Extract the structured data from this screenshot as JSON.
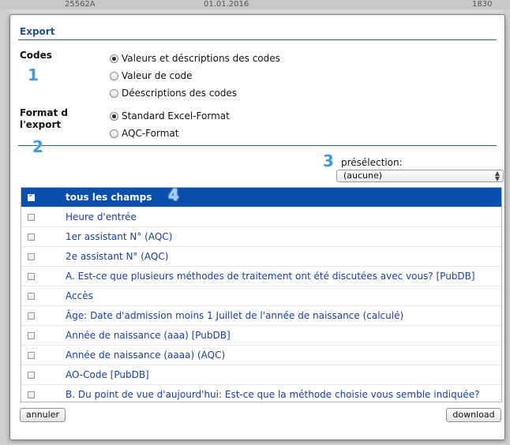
{
  "background": {
    "top_texts": [
      "25562A",
      "01.01.2016",
      "1830"
    ]
  },
  "dialog": {
    "title": "Export",
    "codes": {
      "label": "Codes",
      "badge": "1",
      "options": [
        {
          "label": "Valeurs et déscriptions des codes",
          "checked": true
        },
        {
          "label": "Valeur de code",
          "checked": false
        },
        {
          "label": "Déescriptions des codes",
          "checked": false
        }
      ]
    },
    "format": {
      "label_line1": "Format d",
      "label_line2": "l'export",
      "options": [
        {
          "label": "Standard Excel-Format",
          "checked": true
        },
        {
          "label": "AQC-Format",
          "checked": false
        }
      ]
    },
    "badge2": "2",
    "preselection": {
      "badge": "3",
      "label": "présélection:",
      "value": "(aucune)"
    },
    "list": {
      "badge": "4",
      "items": [
        {
          "label": "tous les champs",
          "checked": true
        },
        {
          "label": "Heure d'entrée",
          "checked": false
        },
        {
          "label": "1er assistant N° (AQC)",
          "checked": false
        },
        {
          "label": "2e assistant N° (AQC)",
          "checked": false
        },
        {
          "label": "A. Est-ce que plusieurs méthodes de traitement ont été discutées avec vous? [PubDB]",
          "checked": false
        },
        {
          "label": "Accès",
          "checked": false
        },
        {
          "label": "Âge: Date d'admission moins 1 Juillet de l'année de naissance (calculé)",
          "checked": false
        },
        {
          "label": "Année de naissance (aaa) [PubDB]",
          "checked": false
        },
        {
          "label": "Année de naissance (aaaa) (AQC)",
          "checked": false
        },
        {
          "label": "AO-Code [PubDB]",
          "checked": false
        },
        {
          "label": "B. Du point de vue d'aujourd'hui: Est-ce que la méthode choisie vous semble indiquée?",
          "checked": false
        }
      ]
    },
    "buttons": {
      "cancel": "annuler",
      "download": "download"
    }
  }
}
